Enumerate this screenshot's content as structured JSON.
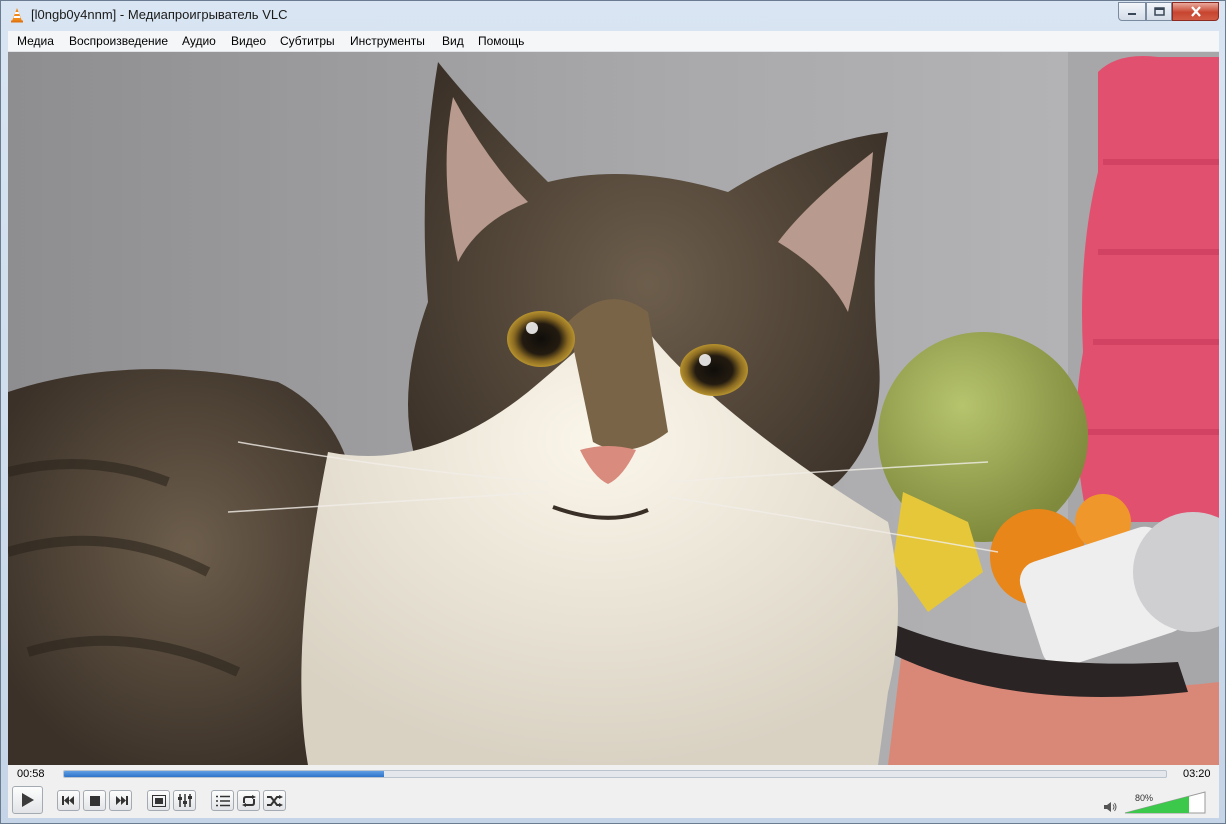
{
  "window": {
    "title": "[l0ngb0y4nnm] - Медиапроигрыватель VLC"
  },
  "menu": {
    "items": [
      {
        "label": "Медиа"
      },
      {
        "label": "Воспроизведение"
      },
      {
        "label": "Аудио"
      },
      {
        "label": "Видео"
      },
      {
        "label": "Субтитры"
      },
      {
        "label": "Инструменты"
      },
      {
        "label": "Вид"
      },
      {
        "label": "Помощь"
      }
    ]
  },
  "player": {
    "elapsed": "00:58",
    "total": "03:20",
    "progress": 0.29,
    "volume_label": "80%",
    "volume": 0.8
  },
  "icons": {
    "app": "vlc-cone-icon",
    "play": "play-icon",
    "previous": "previous-icon",
    "stop": "stop-icon",
    "next": "next-icon",
    "fullscreen": "fullscreen-icon",
    "extended": "extended-settings-icon",
    "playlist": "playlist-icon",
    "loop": "loop-icon",
    "shuffle": "shuffle-icon",
    "mute": "speaker-icon"
  },
  "colors": {
    "seek_fill": "#2e73c9",
    "volume_fill": "#3cc84a",
    "close_button": "#c7452f"
  }
}
